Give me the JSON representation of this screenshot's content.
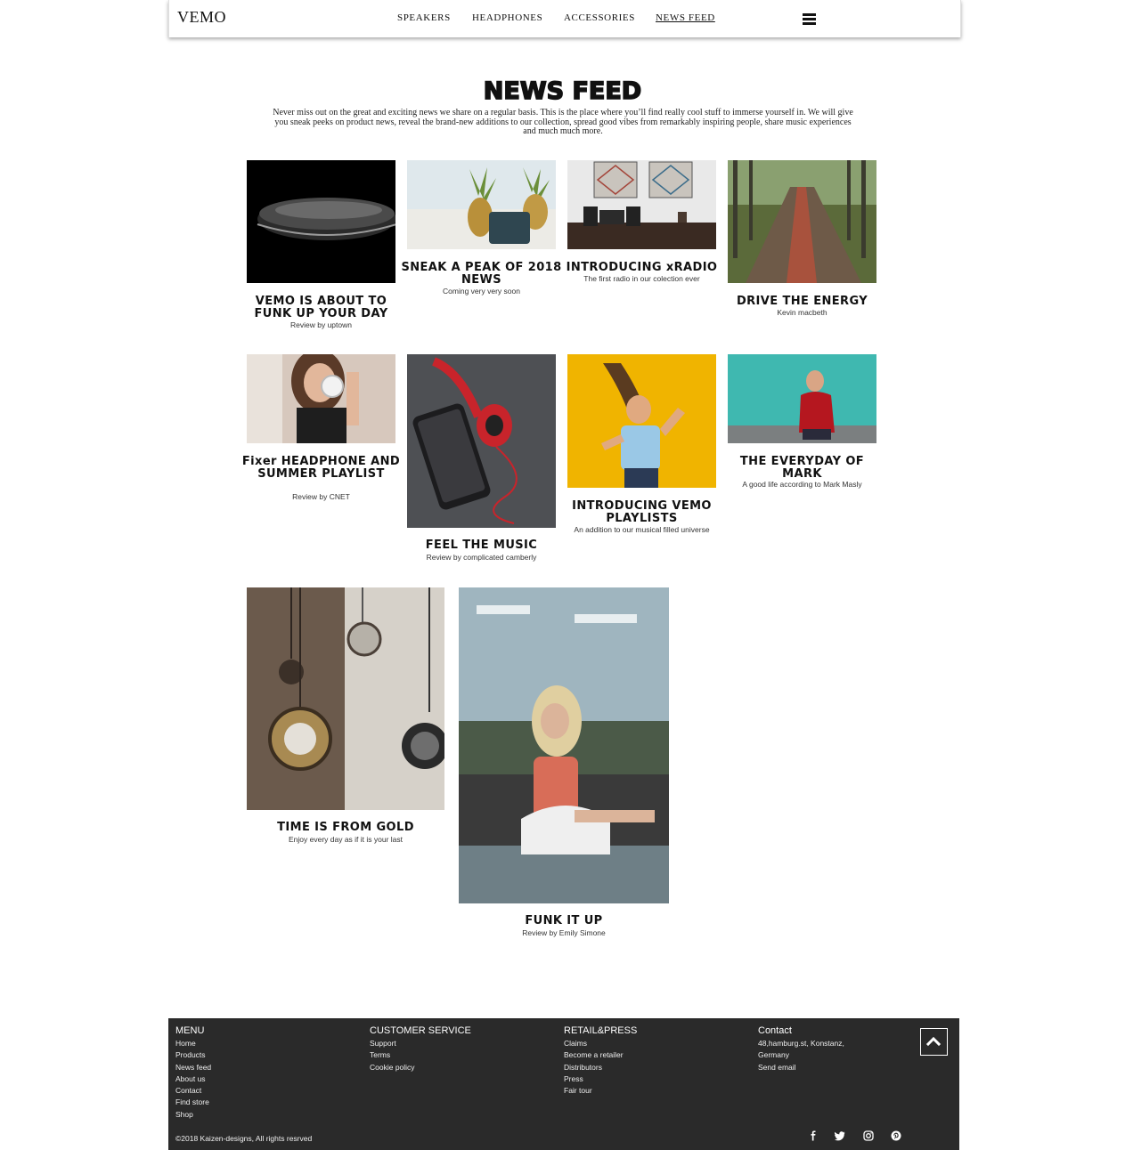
{
  "header": {
    "logo": "VEMO",
    "nav": [
      {
        "label": "SPEAKERS"
      },
      {
        "label": "HEADPHONES"
      },
      {
        "label": "ACCESSORIES"
      },
      {
        "label": "NEWS FEED",
        "active": true
      }
    ],
    "menu_icon": "hamburger-icon"
  },
  "page": {
    "title": "NEWS FEED",
    "intro": "Never miss out on the great and exciting news we share on a regular basis. This is the place where you’ll find really cool stuff to immerse yourself in. We will give you sneak peeks on product news, reveal the brand-new additions to our collection, spread good vibes from remarkably inspiring people, share music experiences and much much more."
  },
  "cards": [
    {
      "title": "VEMO IS ABOUT TO FUNK UP YOUR DAY",
      "sub": "Review by uptown"
    },
    {
      "title": "SNEAK A PEAK OF 2018 NEWS",
      "sub": "Coming very very soon"
    },
    {
      "title": "INTRODUCING xRADIO",
      "sub": "The first radio in our colection ever"
    },
    {
      "title": "DRIVE THE ENERGY",
      "sub": "Kevin macbeth"
    },
    {
      "title": "Fixer HEADPHONE AND SUMMER PLAYLIST",
      "sub": "Review by CNET"
    },
    {
      "title": "FEEL THE MUSIC",
      "sub": "Review by complicated camberly"
    },
    {
      "title": "INTRODUCING VEMO PLAYLISTS",
      "sub": "An addition to our musical filled universe"
    },
    {
      "title": "THE EVERYDAY OF MARK",
      "sub": "A good life according to Mark Masly"
    },
    {
      "title": "TIME IS FROM GOLD",
      "sub": "Enjoy every day as if it is your last"
    },
    {
      "title": "FUNK IT UP",
      "sub": "Review by Emily Simone"
    }
  ],
  "footer": {
    "menu": {
      "heading": "MENU",
      "items": [
        "Home",
        "Products",
        "News feed",
        "About us",
        "Contact",
        "Find store",
        "Shop"
      ]
    },
    "customer_service": {
      "heading": "CUSTOMER SERVICE",
      "items": [
        "Support",
        "Terms",
        "Cookie policy"
      ]
    },
    "retail_press": {
      "heading": "RETAIL&PRESS",
      "items": [
        "Claims",
        "Become a retailer",
        "Distributors",
        "Press",
        "Fair tour"
      ]
    },
    "contact": {
      "heading": "Contact",
      "items": [
        "48,hamburg.st, Konstanz,",
        "Germany",
        "Send email"
      ]
    },
    "copyright": "©2018 Kaizen-designs, All rights resrved",
    "social_icons": [
      "facebook-icon",
      "twitter-icon",
      "instagram-icon",
      "pinterest-icon"
    ],
    "back_to_top_icon": "chevron-up-icon"
  }
}
